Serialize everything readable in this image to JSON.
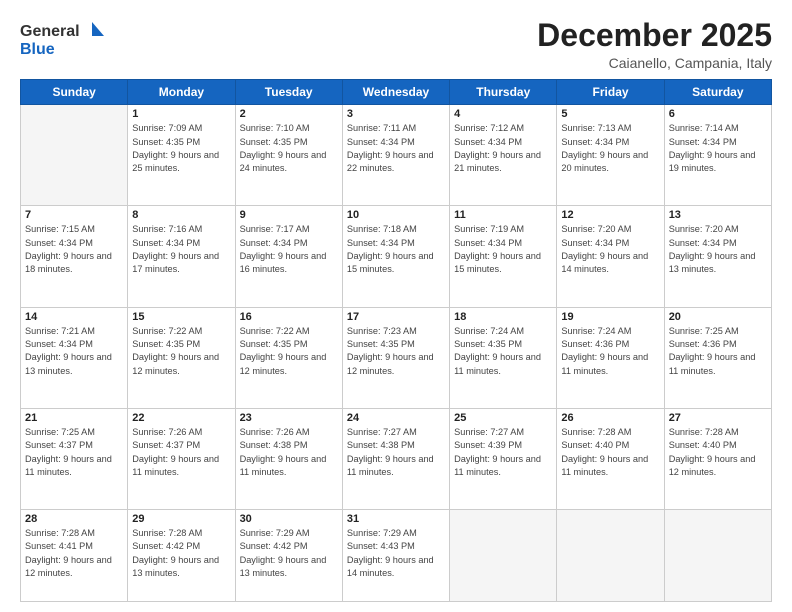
{
  "header": {
    "logo_line1": "General",
    "logo_line2": "Blue",
    "month": "December 2025",
    "location": "Caianello, Campania, Italy"
  },
  "days_of_week": [
    "Sunday",
    "Monday",
    "Tuesday",
    "Wednesday",
    "Thursday",
    "Friday",
    "Saturday"
  ],
  "weeks": [
    [
      {
        "day": "",
        "empty": true
      },
      {
        "day": "1",
        "sunrise": "7:09 AM",
        "sunset": "4:35 PM",
        "daylight": "9 hours and 25 minutes."
      },
      {
        "day": "2",
        "sunrise": "7:10 AM",
        "sunset": "4:35 PM",
        "daylight": "9 hours and 24 minutes."
      },
      {
        "day": "3",
        "sunrise": "7:11 AM",
        "sunset": "4:34 PM",
        "daylight": "9 hours and 22 minutes."
      },
      {
        "day": "4",
        "sunrise": "7:12 AM",
        "sunset": "4:34 PM",
        "daylight": "9 hours and 21 minutes."
      },
      {
        "day": "5",
        "sunrise": "7:13 AM",
        "sunset": "4:34 PM",
        "daylight": "9 hours and 20 minutes."
      },
      {
        "day": "6",
        "sunrise": "7:14 AM",
        "sunset": "4:34 PM",
        "daylight": "9 hours and 19 minutes."
      }
    ],
    [
      {
        "day": "7",
        "sunrise": "7:15 AM",
        "sunset": "4:34 PM",
        "daylight": "9 hours and 18 minutes."
      },
      {
        "day": "8",
        "sunrise": "7:16 AM",
        "sunset": "4:34 PM",
        "daylight": "9 hours and 17 minutes."
      },
      {
        "day": "9",
        "sunrise": "7:17 AM",
        "sunset": "4:34 PM",
        "daylight": "9 hours and 16 minutes."
      },
      {
        "day": "10",
        "sunrise": "7:18 AM",
        "sunset": "4:34 PM",
        "daylight": "9 hours and 15 minutes."
      },
      {
        "day": "11",
        "sunrise": "7:19 AM",
        "sunset": "4:34 PM",
        "daylight": "9 hours and 15 minutes."
      },
      {
        "day": "12",
        "sunrise": "7:20 AM",
        "sunset": "4:34 PM",
        "daylight": "9 hours and 14 minutes."
      },
      {
        "day": "13",
        "sunrise": "7:20 AM",
        "sunset": "4:34 PM",
        "daylight": "9 hours and 13 minutes."
      }
    ],
    [
      {
        "day": "14",
        "sunrise": "7:21 AM",
        "sunset": "4:34 PM",
        "daylight": "9 hours and 13 minutes."
      },
      {
        "day": "15",
        "sunrise": "7:22 AM",
        "sunset": "4:35 PM",
        "daylight": "9 hours and 12 minutes."
      },
      {
        "day": "16",
        "sunrise": "7:22 AM",
        "sunset": "4:35 PM",
        "daylight": "9 hours and 12 minutes."
      },
      {
        "day": "17",
        "sunrise": "7:23 AM",
        "sunset": "4:35 PM",
        "daylight": "9 hours and 12 minutes."
      },
      {
        "day": "18",
        "sunrise": "7:24 AM",
        "sunset": "4:35 PM",
        "daylight": "9 hours and 11 minutes."
      },
      {
        "day": "19",
        "sunrise": "7:24 AM",
        "sunset": "4:36 PM",
        "daylight": "9 hours and 11 minutes."
      },
      {
        "day": "20",
        "sunrise": "7:25 AM",
        "sunset": "4:36 PM",
        "daylight": "9 hours and 11 minutes."
      }
    ],
    [
      {
        "day": "21",
        "sunrise": "7:25 AM",
        "sunset": "4:37 PM",
        "daylight": "9 hours and 11 minutes."
      },
      {
        "day": "22",
        "sunrise": "7:26 AM",
        "sunset": "4:37 PM",
        "daylight": "9 hours and 11 minutes."
      },
      {
        "day": "23",
        "sunrise": "7:26 AM",
        "sunset": "4:38 PM",
        "daylight": "9 hours and 11 minutes."
      },
      {
        "day": "24",
        "sunrise": "7:27 AM",
        "sunset": "4:38 PM",
        "daylight": "9 hours and 11 minutes."
      },
      {
        "day": "25",
        "sunrise": "7:27 AM",
        "sunset": "4:39 PM",
        "daylight": "9 hours and 11 minutes."
      },
      {
        "day": "26",
        "sunrise": "7:28 AM",
        "sunset": "4:40 PM",
        "daylight": "9 hours and 11 minutes."
      },
      {
        "day": "27",
        "sunrise": "7:28 AM",
        "sunset": "4:40 PM",
        "daylight": "9 hours and 12 minutes."
      }
    ],
    [
      {
        "day": "28",
        "sunrise": "7:28 AM",
        "sunset": "4:41 PM",
        "daylight": "9 hours and 12 minutes."
      },
      {
        "day": "29",
        "sunrise": "7:28 AM",
        "sunset": "4:42 PM",
        "daylight": "9 hours and 13 minutes."
      },
      {
        "day": "30",
        "sunrise": "7:29 AM",
        "sunset": "4:42 PM",
        "daylight": "9 hours and 13 minutes."
      },
      {
        "day": "31",
        "sunrise": "7:29 AM",
        "sunset": "4:43 PM",
        "daylight": "9 hours and 14 minutes."
      },
      {
        "day": "",
        "empty": true
      },
      {
        "day": "",
        "empty": true
      },
      {
        "day": "",
        "empty": true
      }
    ]
  ]
}
